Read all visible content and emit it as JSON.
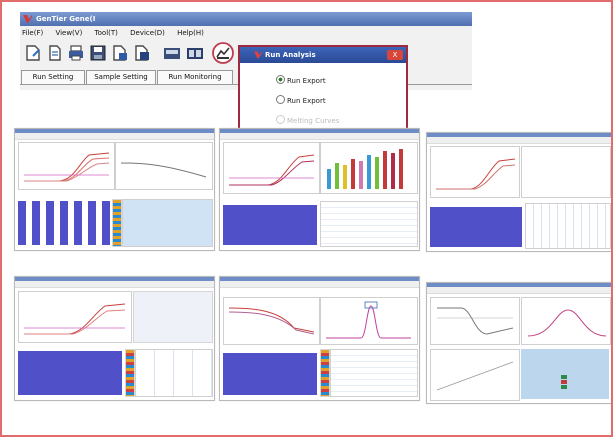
{
  "app": {
    "title": "GenTier Gene(I",
    "menu": [
      "File(F)",
      "View(V)",
      "Tool(T)",
      "Device(D)",
      "Help(H)"
    ],
    "toolbar_icons": [
      "new-file-icon",
      "open-file-icon",
      "print-icon",
      "save-icon",
      "export-icon",
      "import-icon",
      "device-icon",
      "instrument-icon",
      "analysis-icon"
    ],
    "tabs": [
      "Run Setting",
      "Sample Setting",
      "Run Monitoring"
    ]
  },
  "dialog": {
    "title": "Run Analysis",
    "close_label": "X",
    "options": [
      {
        "label": "Run Export",
        "selected": true,
        "enabled": true
      },
      {
        "label": "Run Export",
        "selected": false,
        "enabled": true
      },
      {
        "label": "Melting Curves",
        "selected": false,
        "enabled": false
      }
    ]
  },
  "colors": {
    "frame_border": "#e06c6c",
    "well_plate": "#5050c8",
    "dialog_border": "#9e2a40",
    "title_bar": "#4f6fb0"
  }
}
